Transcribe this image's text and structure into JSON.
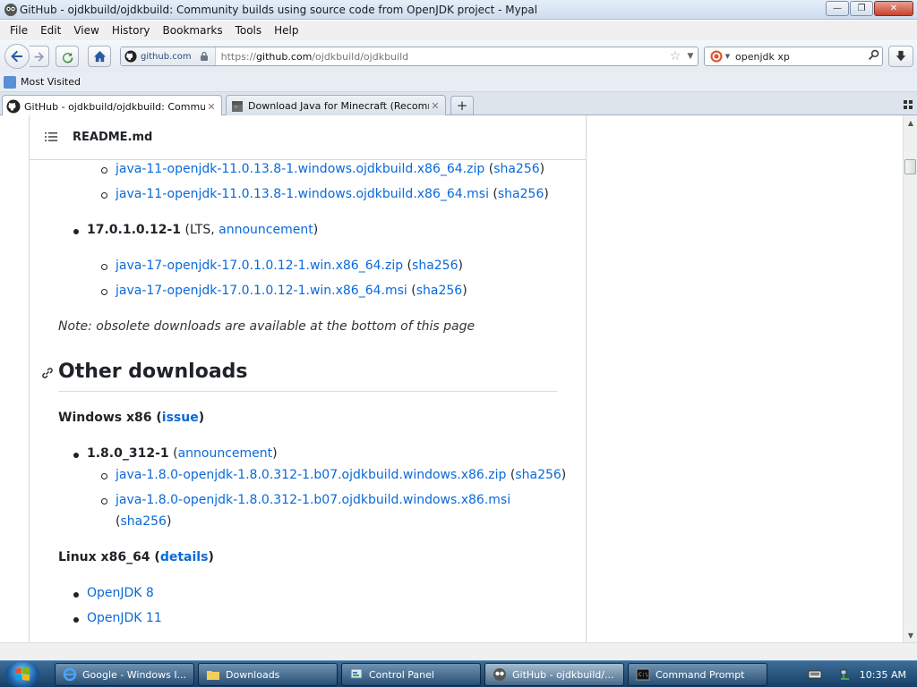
{
  "window": {
    "title": "GitHub - ojdkbuild/ojdkbuild: Community builds using source code from OpenJDK project - Mypal"
  },
  "menu": [
    "File",
    "Edit",
    "View",
    "History",
    "Bookmarks",
    "Tools",
    "Help"
  ],
  "urlbar": {
    "site_identity": "github.com",
    "url_prefix": "https://",
    "url_host": "github.com",
    "url_path": "/ojdkbuild/ojdkbuild"
  },
  "search": {
    "value": "openjdk xp"
  },
  "bookmarks": {
    "most_visited": "Most Visited"
  },
  "tabs": [
    {
      "label": "GitHub - ojdkbuild/ojdkbuild: Community b...",
      "active": true
    },
    {
      "label": "Download Java for Minecraft (Recomme...",
      "active": false
    }
  ],
  "readme": {
    "title": "README.md",
    "java11_zip": "java-11-openjdk-11.0.13.8-1.windows.ojdkbuild.x86_64.zip",
    "java11_msi": "java-11-openjdk-11.0.13.8-1.windows.ojdkbuild.x86_64.msi",
    "sha256": "sha256",
    "v17": "17.0.1.0.12-1",
    "lts": "LTS",
    "announcement": "announcement",
    "java17_zip": "java-17-openjdk-17.0.1.0.12-1.win.x86_64.zip",
    "java17_msi": "java-17-openjdk-17.0.1.0.12-1.win.x86_64.msi",
    "note": "Note: obsolete downloads are available at the bottom of this page",
    "other_downloads": "Other downloads",
    "windows_x86": "Windows x86",
    "issue": "issue",
    "v18": "1.8.0_312-1",
    "java8_zip": "java-1.8.0-openjdk-1.8.0.312-1.b07.ojdkbuild.windows.x86.zip",
    "java8_msi": "java-1.8.0-openjdk-1.8.0.312-1.b07.ojdkbuild.windows.x86.msi",
    "linux": "Linux x86_64",
    "details": "details",
    "openjdk8": "OpenJDK 8",
    "openjdk11": "OpenJDK 11"
  },
  "taskbar": {
    "tasks": [
      "Google - Windows I...",
      "Downloads",
      "Control Panel",
      "GitHub - ojdkbuild/...",
      "Command Prompt"
    ],
    "clock": "10:35 AM"
  },
  "colors": {
    "link": "#0969da",
    "text": "#1f2328",
    "taskbar": "#1f4a74"
  }
}
